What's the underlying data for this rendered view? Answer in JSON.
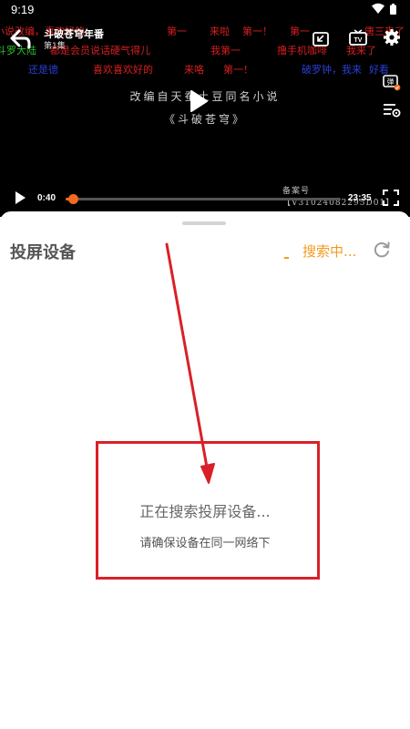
{
  "status_bar": {
    "time": "9:19"
  },
  "video": {
    "title": "斗破苍穹年番",
    "episode": "第1集",
    "subtitle_line1": "改编自天蚕土豆同名小说",
    "subtitle_line2": "《斗破苍穹》",
    "watermark": "备案号【V31024082295D01】",
    "time_current": "0:40",
    "time_total": "23:35",
    "progress": 0.028,
    "danmaku": [
      {
        "text": "小说改编，喜欢好的",
        "color": "#d71f1f"
      },
      {
        "text": "第一",
        "color": "#d71f1f"
      },
      {
        "text": "来啦",
        "color": "#d71f1f"
      },
      {
        "text": "第一！",
        "color": "#d71f1f"
      },
      {
        "text": "第一",
        "color": "#d71f1f"
      },
      {
        "text": "唐三来了",
        "color": "#d71f1f"
      },
      {
        "text": "斗罗大陆",
        "color": "#2bbf2b"
      },
      {
        "text": "都是会员说话硬气得儿",
        "color": "#d71f1f"
      },
      {
        "text": "我第一",
        "color": "#d71f1f"
      },
      {
        "text": "撸手机咖啡",
        "color": "#d71f1f"
      },
      {
        "text": "我来了",
        "color": "#d71f1f"
      },
      {
        "text": "还是德",
        "color": "#2a3fd4"
      },
      {
        "text": "喜欢喜欢好的",
        "color": "#d71f1f"
      },
      {
        "text": "来咯",
        "color": "#d71f1f"
      },
      {
        "text": "第一！",
        "color": "#d71f1f"
      },
      {
        "text": "破罗钟，",
        "color": "#2a3fd4"
      },
      {
        "text": "我来",
        "color": "#2a3fd4"
      },
      {
        "text": "好看",
        "color": "#2a3fd4"
      }
    ]
  },
  "sheet": {
    "title": "投屏设备",
    "searching_label": "搜索中...",
    "status_main": "正在搜索投屏设备...",
    "status_hint": "请确保设备在同一网络下"
  },
  "annotation": {
    "color": "#d92027"
  },
  "colors": {
    "accent": "#f26b1d",
    "searching": "#f39a1e"
  }
}
